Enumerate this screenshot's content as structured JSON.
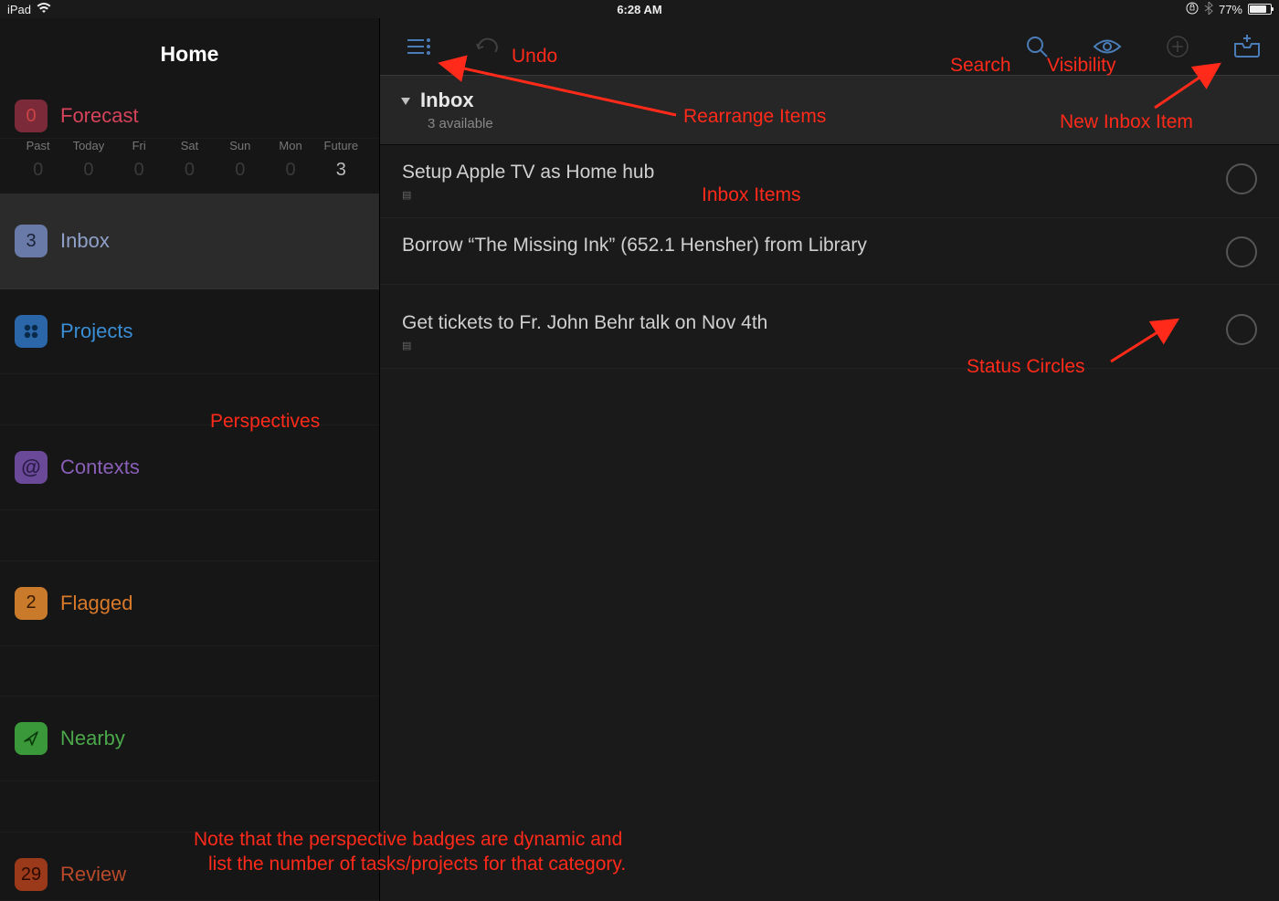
{
  "statusbar": {
    "device": "iPad",
    "time": "6:28 AM",
    "battery_pct": "77%"
  },
  "sidebar": {
    "title": "Home",
    "forecast_days": [
      "Past",
      "Today",
      "Fri",
      "Sat",
      "Sun",
      "Mon",
      "Future"
    ],
    "forecast_counts": [
      "0",
      "0",
      "0",
      "0",
      "0",
      "0",
      "3"
    ],
    "perspectives": [
      {
        "badge": "0",
        "label": "Forecast",
        "color": "#d6435a",
        "text_color": "#d6435a"
      },
      {
        "badge": "3",
        "label": "Inbox",
        "color": "#9aa8d6",
        "text_color": "#8fa0c9",
        "selected": true
      },
      {
        "badge": "",
        "label": "Projects",
        "color": "#3a8ed6",
        "text_color": "#3a8ed6",
        "icon": "projects"
      },
      {
        "badge": "",
        "label": "Contexts",
        "color": "#8a5fb8",
        "text_color": "#8a5fb8",
        "icon": "contexts"
      },
      {
        "badge": "2",
        "label": "Flagged",
        "color": "#d97a2a",
        "text_color": "#d97a2a"
      },
      {
        "badge": "",
        "label": "Nearby",
        "color": "#4aa84a",
        "text_color": "#4aa84a",
        "icon": "nearby"
      },
      {
        "badge": "29",
        "label": "Review",
        "color": "#b84a2a",
        "text_color": "#b84a2a"
      }
    ]
  },
  "main": {
    "header_title": "Inbox",
    "header_sub": "3 available",
    "tasks": [
      {
        "title": "Setup Apple TV as Home hub",
        "has_note": true
      },
      {
        "title": "Borrow “The Missing Ink” (652.1 Hensher) from Library",
        "has_note": false
      },
      {
        "title": "Get tickets to Fr. John Behr talk on Nov 4th",
        "has_note": true
      }
    ]
  },
  "annotations": {
    "undo": "Undo",
    "search": "Search",
    "visibility": "Visibility",
    "rearrange": "Rearrange Items",
    "new_inbox": "New Inbox Item",
    "inbox_items": "Inbox Items",
    "status_circles": "Status Circles",
    "perspectives": "Perspectives",
    "note_line1": "Note that the perspective badges are dynamic and",
    "note_line2": "list the number of tasks/projects for that category."
  }
}
